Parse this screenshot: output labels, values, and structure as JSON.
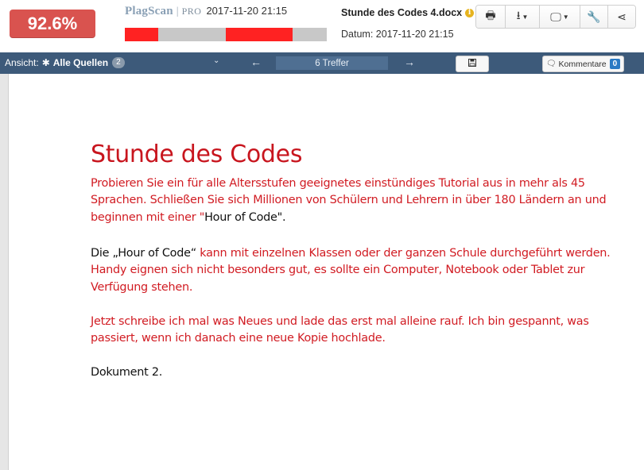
{
  "header": {
    "score": "92.6%",
    "brand": {
      "logo": "PlagScan",
      "separator": "|",
      "edition": "PRO",
      "date": "2017-11-20 21:15"
    },
    "match_segments": [
      {
        "start": 0.0,
        "end": 0.165
      },
      {
        "start": 0.5,
        "end": 0.83
      }
    ],
    "document": {
      "title": "Stunde des Codes 4.docx",
      "date_label": "Datum: 2017-11-20 21:15"
    },
    "buttons": [
      {
        "name": "print-button",
        "icon": "printer-icon",
        "glyph": "🖶",
        "dropdown": false
      },
      {
        "name": "download-button",
        "icon": "download-icon",
        "glyph": "⭳",
        "dropdown": true
      },
      {
        "name": "display-button",
        "icon": "monitor-icon",
        "glyph": "🖵",
        "dropdown": true
      },
      {
        "name": "settings-button",
        "icon": "wrench-icon",
        "glyph": "🔧",
        "dropdown": false
      },
      {
        "name": "share-button",
        "icon": "share-icon",
        "glyph": "⋖",
        "dropdown": false
      }
    ]
  },
  "toolbar": {
    "view_label": "Ansicht:",
    "sources_label": "Alle Quellen",
    "sources_count": "2",
    "hits": "6 Treffer",
    "comments_label": "Kommentare",
    "comments_count": "0"
  },
  "document_body": {
    "title": "Stunde des Codes",
    "p1_red": "Probieren Sie ein für alle Altersstufen geeignetes einstündiges Tutorial aus in mehr als 45 Sprachen. Schließen Sie sich Millionen von Schülern und Lehrern in über 180 Ländern an und beginnen mit einer \"",
    "p1_black": "Hour of Code",
    "p1_end": "\".",
    "p2_black": "Die „Hour of Code“",
    "p2_red": " kann mit einzelnen Klassen oder der ganzen Schule durchgeführt werden. Handy eignen sich nicht besonders gut, es sollte ein Computer, Notebook oder Tablet zur Verfügung stehen.",
    "p3_red": "Jetzt schreibe ich mal was Neues und lade das erst mal alleine rauf. Ich bin gespannt, was passiert, wenn ich danach eine neue Kopie hochlade.",
    "p4_black": "Dokument 2."
  },
  "colors": {
    "score_bg": "#d9534f",
    "toolbar_bg": "#3d5a7a",
    "match_red": "#ff2222",
    "text_red": "#c8151e"
  }
}
